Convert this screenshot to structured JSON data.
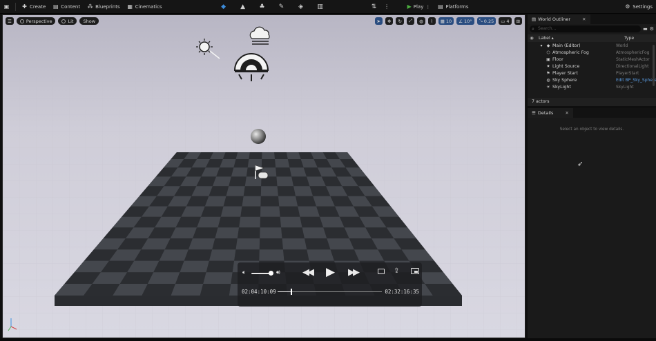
{
  "toolbar": {
    "create_label": "Create",
    "content_label": "Content",
    "blueprints_label": "Blueprints",
    "cinematics_label": "Cinematics",
    "play_label": "Play",
    "platforms_label": "Platforms",
    "settings_label": "Settings"
  },
  "viewport": {
    "perspective_label": "Perspective",
    "lit_label": "Lit",
    "show_label": "Show",
    "grid_snap_value": "10",
    "rotation_snap_value": "10°",
    "scale_snap_value": "0.25",
    "camera_speed_value": "4"
  },
  "player": {
    "elapsed": "02:04:10:09",
    "remaining": "02:32:16:35",
    "progress_fraction": 0.13,
    "volume_fraction": 0.85
  },
  "outliner": {
    "tab_label": "World Outliner",
    "search_placeholder": "Search...",
    "label_header": "Label",
    "type_header": "Type",
    "rows": [
      {
        "name": "Main (Editor)",
        "type": "World"
      },
      {
        "name": "Atmospheric Fog",
        "type": "AtmosphericFog"
      },
      {
        "name": "Floor",
        "type": "StaticMeshActor"
      },
      {
        "name": "Light Source",
        "type": "DirectionalLight"
      },
      {
        "name": "Player Start",
        "type": "PlayerStart"
      },
      {
        "name": "Sky Sphere",
        "type": "Edit BP_Sky_Sphere"
      },
      {
        "name": "SkyLight",
        "type": "SkyLight"
      }
    ],
    "count_label": "7 actors"
  },
  "details": {
    "tab_label": "Details",
    "empty_message": "Select an object to view details."
  },
  "colors": {
    "accent_blue": "#2a4d80",
    "play_green": "#4caf3f",
    "link_blue": "#5a9be0"
  }
}
